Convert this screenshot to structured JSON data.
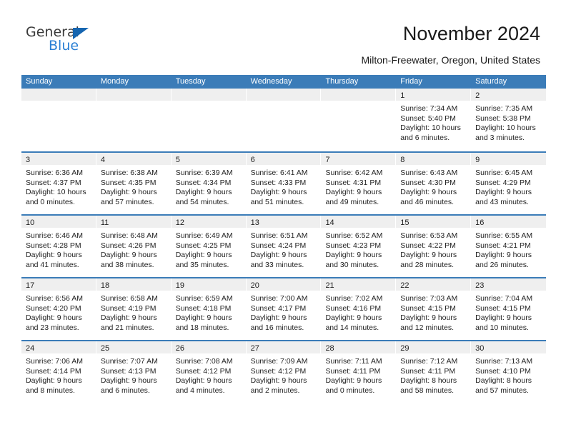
{
  "brand": {
    "name_part1": "General",
    "name_part2": "Blue",
    "triangle_color": "#1565b0",
    "blue_color": "#2a7fd4"
  },
  "header": {
    "title": "November 2024",
    "subtitle": "Milton-Freewater, Oregon, United States",
    "accent_color": "#3b7cb8",
    "numbar_color": "#efefef"
  },
  "weekday_headers": [
    "Sunday",
    "Monday",
    "Tuesday",
    "Wednesday",
    "Thursday",
    "Friday",
    "Saturday"
  ],
  "weeks": [
    [
      {
        "day": "",
        "sunrise": "",
        "sunset": "",
        "daylight_line1": "",
        "daylight_line2": ""
      },
      {
        "day": "",
        "sunrise": "",
        "sunset": "",
        "daylight_line1": "",
        "daylight_line2": ""
      },
      {
        "day": "",
        "sunrise": "",
        "sunset": "",
        "daylight_line1": "",
        "daylight_line2": ""
      },
      {
        "day": "",
        "sunrise": "",
        "sunset": "",
        "daylight_line1": "",
        "daylight_line2": ""
      },
      {
        "day": "",
        "sunrise": "",
        "sunset": "",
        "daylight_line1": "",
        "daylight_line2": ""
      },
      {
        "day": "1",
        "sunrise": "Sunrise: 7:34 AM",
        "sunset": "Sunset: 5:40 PM",
        "daylight_line1": "Daylight: 10 hours",
        "daylight_line2": "and 6 minutes."
      },
      {
        "day": "2",
        "sunrise": "Sunrise: 7:35 AM",
        "sunset": "Sunset: 5:38 PM",
        "daylight_line1": "Daylight: 10 hours",
        "daylight_line2": "and 3 minutes."
      }
    ],
    [
      {
        "day": "3",
        "sunrise": "Sunrise: 6:36 AM",
        "sunset": "Sunset: 4:37 PM",
        "daylight_line1": "Daylight: 10 hours",
        "daylight_line2": "and 0 minutes."
      },
      {
        "day": "4",
        "sunrise": "Sunrise: 6:38 AM",
        "sunset": "Sunset: 4:35 PM",
        "daylight_line1": "Daylight: 9 hours",
        "daylight_line2": "and 57 minutes."
      },
      {
        "day": "5",
        "sunrise": "Sunrise: 6:39 AM",
        "sunset": "Sunset: 4:34 PM",
        "daylight_line1": "Daylight: 9 hours",
        "daylight_line2": "and 54 minutes."
      },
      {
        "day": "6",
        "sunrise": "Sunrise: 6:41 AM",
        "sunset": "Sunset: 4:33 PM",
        "daylight_line1": "Daylight: 9 hours",
        "daylight_line2": "and 51 minutes."
      },
      {
        "day": "7",
        "sunrise": "Sunrise: 6:42 AM",
        "sunset": "Sunset: 4:31 PM",
        "daylight_line1": "Daylight: 9 hours",
        "daylight_line2": "and 49 minutes."
      },
      {
        "day": "8",
        "sunrise": "Sunrise: 6:43 AM",
        "sunset": "Sunset: 4:30 PM",
        "daylight_line1": "Daylight: 9 hours",
        "daylight_line2": "and 46 minutes."
      },
      {
        "day": "9",
        "sunrise": "Sunrise: 6:45 AM",
        "sunset": "Sunset: 4:29 PM",
        "daylight_line1": "Daylight: 9 hours",
        "daylight_line2": "and 43 minutes."
      }
    ],
    [
      {
        "day": "10",
        "sunrise": "Sunrise: 6:46 AM",
        "sunset": "Sunset: 4:28 PM",
        "daylight_line1": "Daylight: 9 hours",
        "daylight_line2": "and 41 minutes."
      },
      {
        "day": "11",
        "sunrise": "Sunrise: 6:48 AM",
        "sunset": "Sunset: 4:26 PM",
        "daylight_line1": "Daylight: 9 hours",
        "daylight_line2": "and 38 minutes."
      },
      {
        "day": "12",
        "sunrise": "Sunrise: 6:49 AM",
        "sunset": "Sunset: 4:25 PM",
        "daylight_line1": "Daylight: 9 hours",
        "daylight_line2": "and 35 minutes."
      },
      {
        "day": "13",
        "sunrise": "Sunrise: 6:51 AM",
        "sunset": "Sunset: 4:24 PM",
        "daylight_line1": "Daylight: 9 hours",
        "daylight_line2": "and 33 minutes."
      },
      {
        "day": "14",
        "sunrise": "Sunrise: 6:52 AM",
        "sunset": "Sunset: 4:23 PM",
        "daylight_line1": "Daylight: 9 hours",
        "daylight_line2": "and 30 minutes."
      },
      {
        "day": "15",
        "sunrise": "Sunrise: 6:53 AM",
        "sunset": "Sunset: 4:22 PM",
        "daylight_line1": "Daylight: 9 hours",
        "daylight_line2": "and 28 minutes."
      },
      {
        "day": "16",
        "sunrise": "Sunrise: 6:55 AM",
        "sunset": "Sunset: 4:21 PM",
        "daylight_line1": "Daylight: 9 hours",
        "daylight_line2": "and 26 minutes."
      }
    ],
    [
      {
        "day": "17",
        "sunrise": "Sunrise: 6:56 AM",
        "sunset": "Sunset: 4:20 PM",
        "daylight_line1": "Daylight: 9 hours",
        "daylight_line2": "and 23 minutes."
      },
      {
        "day": "18",
        "sunrise": "Sunrise: 6:58 AM",
        "sunset": "Sunset: 4:19 PM",
        "daylight_line1": "Daylight: 9 hours",
        "daylight_line2": "and 21 minutes."
      },
      {
        "day": "19",
        "sunrise": "Sunrise: 6:59 AM",
        "sunset": "Sunset: 4:18 PM",
        "daylight_line1": "Daylight: 9 hours",
        "daylight_line2": "and 18 minutes."
      },
      {
        "day": "20",
        "sunrise": "Sunrise: 7:00 AM",
        "sunset": "Sunset: 4:17 PM",
        "daylight_line1": "Daylight: 9 hours",
        "daylight_line2": "and 16 minutes."
      },
      {
        "day": "21",
        "sunrise": "Sunrise: 7:02 AM",
        "sunset": "Sunset: 4:16 PM",
        "daylight_line1": "Daylight: 9 hours",
        "daylight_line2": "and 14 minutes."
      },
      {
        "day": "22",
        "sunrise": "Sunrise: 7:03 AM",
        "sunset": "Sunset: 4:15 PM",
        "daylight_line1": "Daylight: 9 hours",
        "daylight_line2": "and 12 minutes."
      },
      {
        "day": "23",
        "sunrise": "Sunrise: 7:04 AM",
        "sunset": "Sunset: 4:15 PM",
        "daylight_line1": "Daylight: 9 hours",
        "daylight_line2": "and 10 minutes."
      }
    ],
    [
      {
        "day": "24",
        "sunrise": "Sunrise: 7:06 AM",
        "sunset": "Sunset: 4:14 PM",
        "daylight_line1": "Daylight: 9 hours",
        "daylight_line2": "and 8 minutes."
      },
      {
        "day": "25",
        "sunrise": "Sunrise: 7:07 AM",
        "sunset": "Sunset: 4:13 PM",
        "daylight_line1": "Daylight: 9 hours",
        "daylight_line2": "and 6 minutes."
      },
      {
        "day": "26",
        "sunrise": "Sunrise: 7:08 AM",
        "sunset": "Sunset: 4:12 PM",
        "daylight_line1": "Daylight: 9 hours",
        "daylight_line2": "and 4 minutes."
      },
      {
        "day": "27",
        "sunrise": "Sunrise: 7:09 AM",
        "sunset": "Sunset: 4:12 PM",
        "daylight_line1": "Daylight: 9 hours",
        "daylight_line2": "and 2 minutes."
      },
      {
        "day": "28",
        "sunrise": "Sunrise: 7:11 AM",
        "sunset": "Sunset: 4:11 PM",
        "daylight_line1": "Daylight: 9 hours",
        "daylight_line2": "and 0 minutes."
      },
      {
        "day": "29",
        "sunrise": "Sunrise: 7:12 AM",
        "sunset": "Sunset: 4:11 PM",
        "daylight_line1": "Daylight: 8 hours",
        "daylight_line2": "and 58 minutes."
      },
      {
        "day": "30",
        "sunrise": "Sunrise: 7:13 AM",
        "sunset": "Sunset: 4:10 PM",
        "daylight_line1": "Daylight: 8 hours",
        "daylight_line2": "and 57 minutes."
      }
    ]
  ]
}
